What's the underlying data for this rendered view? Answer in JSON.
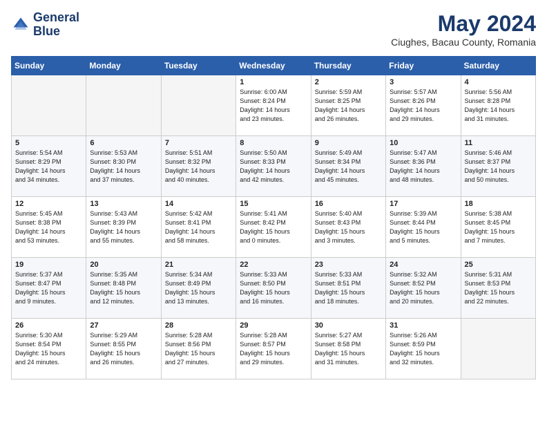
{
  "logo": {
    "line1": "General",
    "line2": "Blue"
  },
  "title": "May 2024",
  "location": "Ciughes, Bacau County, Romania",
  "weekdays": [
    "Sunday",
    "Monday",
    "Tuesday",
    "Wednesday",
    "Thursday",
    "Friday",
    "Saturday"
  ],
  "weeks": [
    [
      {
        "day": "",
        "info": ""
      },
      {
        "day": "",
        "info": ""
      },
      {
        "day": "",
        "info": ""
      },
      {
        "day": "1",
        "info": "Sunrise: 6:00 AM\nSunset: 8:24 PM\nDaylight: 14 hours\nand 23 minutes."
      },
      {
        "day": "2",
        "info": "Sunrise: 5:59 AM\nSunset: 8:25 PM\nDaylight: 14 hours\nand 26 minutes."
      },
      {
        "day": "3",
        "info": "Sunrise: 5:57 AM\nSunset: 8:26 PM\nDaylight: 14 hours\nand 29 minutes."
      },
      {
        "day": "4",
        "info": "Sunrise: 5:56 AM\nSunset: 8:28 PM\nDaylight: 14 hours\nand 31 minutes."
      }
    ],
    [
      {
        "day": "5",
        "info": "Sunrise: 5:54 AM\nSunset: 8:29 PM\nDaylight: 14 hours\nand 34 minutes."
      },
      {
        "day": "6",
        "info": "Sunrise: 5:53 AM\nSunset: 8:30 PM\nDaylight: 14 hours\nand 37 minutes."
      },
      {
        "day": "7",
        "info": "Sunrise: 5:51 AM\nSunset: 8:32 PM\nDaylight: 14 hours\nand 40 minutes."
      },
      {
        "day": "8",
        "info": "Sunrise: 5:50 AM\nSunset: 8:33 PM\nDaylight: 14 hours\nand 42 minutes."
      },
      {
        "day": "9",
        "info": "Sunrise: 5:49 AM\nSunset: 8:34 PM\nDaylight: 14 hours\nand 45 minutes."
      },
      {
        "day": "10",
        "info": "Sunrise: 5:47 AM\nSunset: 8:36 PM\nDaylight: 14 hours\nand 48 minutes."
      },
      {
        "day": "11",
        "info": "Sunrise: 5:46 AM\nSunset: 8:37 PM\nDaylight: 14 hours\nand 50 minutes."
      }
    ],
    [
      {
        "day": "12",
        "info": "Sunrise: 5:45 AM\nSunset: 8:38 PM\nDaylight: 14 hours\nand 53 minutes."
      },
      {
        "day": "13",
        "info": "Sunrise: 5:43 AM\nSunset: 8:39 PM\nDaylight: 14 hours\nand 55 minutes."
      },
      {
        "day": "14",
        "info": "Sunrise: 5:42 AM\nSunset: 8:41 PM\nDaylight: 14 hours\nand 58 minutes."
      },
      {
        "day": "15",
        "info": "Sunrise: 5:41 AM\nSunset: 8:42 PM\nDaylight: 15 hours\nand 0 minutes."
      },
      {
        "day": "16",
        "info": "Sunrise: 5:40 AM\nSunset: 8:43 PM\nDaylight: 15 hours\nand 3 minutes."
      },
      {
        "day": "17",
        "info": "Sunrise: 5:39 AM\nSunset: 8:44 PM\nDaylight: 15 hours\nand 5 minutes."
      },
      {
        "day": "18",
        "info": "Sunrise: 5:38 AM\nSunset: 8:45 PM\nDaylight: 15 hours\nand 7 minutes."
      }
    ],
    [
      {
        "day": "19",
        "info": "Sunrise: 5:37 AM\nSunset: 8:47 PM\nDaylight: 15 hours\nand 9 minutes."
      },
      {
        "day": "20",
        "info": "Sunrise: 5:35 AM\nSunset: 8:48 PM\nDaylight: 15 hours\nand 12 minutes."
      },
      {
        "day": "21",
        "info": "Sunrise: 5:34 AM\nSunset: 8:49 PM\nDaylight: 15 hours\nand 13 minutes."
      },
      {
        "day": "22",
        "info": "Sunrise: 5:33 AM\nSunset: 8:50 PM\nDaylight: 15 hours\nand 16 minutes."
      },
      {
        "day": "23",
        "info": "Sunrise: 5:33 AM\nSunset: 8:51 PM\nDaylight: 15 hours\nand 18 minutes."
      },
      {
        "day": "24",
        "info": "Sunrise: 5:32 AM\nSunset: 8:52 PM\nDaylight: 15 hours\nand 20 minutes."
      },
      {
        "day": "25",
        "info": "Sunrise: 5:31 AM\nSunset: 8:53 PM\nDaylight: 15 hours\nand 22 minutes."
      }
    ],
    [
      {
        "day": "26",
        "info": "Sunrise: 5:30 AM\nSunset: 8:54 PM\nDaylight: 15 hours\nand 24 minutes."
      },
      {
        "day": "27",
        "info": "Sunrise: 5:29 AM\nSunset: 8:55 PM\nDaylight: 15 hours\nand 26 minutes."
      },
      {
        "day": "28",
        "info": "Sunrise: 5:28 AM\nSunset: 8:56 PM\nDaylight: 15 hours\nand 27 minutes."
      },
      {
        "day": "29",
        "info": "Sunrise: 5:28 AM\nSunset: 8:57 PM\nDaylight: 15 hours\nand 29 minutes."
      },
      {
        "day": "30",
        "info": "Sunrise: 5:27 AM\nSunset: 8:58 PM\nDaylight: 15 hours\nand 31 minutes."
      },
      {
        "day": "31",
        "info": "Sunrise: 5:26 AM\nSunset: 8:59 PM\nDaylight: 15 hours\nand 32 minutes."
      },
      {
        "day": "",
        "info": ""
      }
    ]
  ]
}
